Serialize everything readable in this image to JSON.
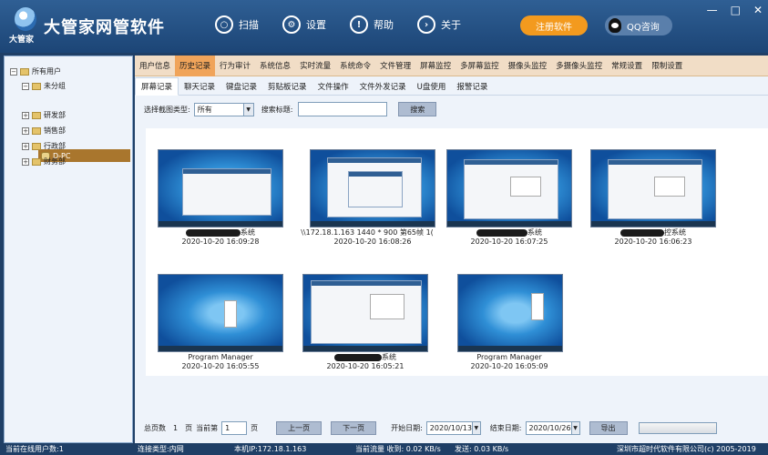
{
  "app": {
    "title": "大管家网管软件",
    "logo_sub": "大管家"
  },
  "topnav": [
    {
      "label": "扫描",
      "glyph": "○"
    },
    {
      "label": "设置",
      "glyph": "⚙"
    },
    {
      "label": "帮助",
      "glyph": "!"
    },
    {
      "label": "关于",
      "glyph": "›"
    }
  ],
  "buttons": {
    "register": "注册软件",
    "qq": "QQ咨询"
  },
  "window_controls": {
    "minimize": "—",
    "maximize": "□",
    "close": "✕"
  },
  "tree": {
    "root": "所有用户",
    "ungrouped": "未分组",
    "selected_pc": "D-PC",
    "departments": [
      "研发部",
      "销售部",
      "行政部",
      "财务部"
    ]
  },
  "tabs_primary": [
    "用户信息",
    "历史记录",
    "行为审计",
    "系统信息",
    "实时流量",
    "系统命令",
    "文件管理",
    "屏幕监控",
    "多屏幕监控",
    "摄像头监控",
    "多摄像头监控",
    "常规设置",
    "限制设置"
  ],
  "tabs_primary_active": 1,
  "tabs_secondary": [
    "屏幕记录",
    "聊天记录",
    "键盘记录",
    "剪贴板记录",
    "文件操作",
    "文件外发记录",
    "U盘使用",
    "报警记录"
  ],
  "tabs_secondary_active": 0,
  "filter": {
    "type_label": "选择截图类型:",
    "type_value": "所有",
    "title_label": "搜索标题:",
    "title_value": "",
    "search_button": "搜索"
  },
  "screenshots": [
    {
      "title_prefix": "",
      "title_suffix": "系统",
      "time": "2020-10-20 16:09:28"
    },
    {
      "title_prefix": "\\\\172.18.1.163 1440 * 900 第65帧 1(",
      "title_suffix": "",
      "time": "2020-10-20 16:08:26"
    },
    {
      "title_prefix": "",
      "title_suffix": "系统",
      "time": "2020-10-20 16:07:25"
    },
    {
      "title_prefix": "",
      "title_suffix": "控系统",
      "time": "2020-10-20 16:06:23"
    },
    {
      "title_prefix": "Program Manager",
      "title_suffix": "",
      "time": "2020-10-20 16:05:55"
    },
    {
      "title_prefix": "",
      "title_suffix": "系统",
      "time": "2020-10-20 16:05:21"
    },
    {
      "title_prefix": "Program Manager",
      "title_suffix": "",
      "time": "2020-10-20 16:05:09"
    }
  ],
  "pager": {
    "total_label": "总页数",
    "total_pages": "1",
    "page_unit": "页",
    "current_label": "当前第",
    "current_page": "1",
    "prev": "上一页",
    "next": "下一页",
    "start_label": "开始日期:",
    "start_date": "2020/10/13",
    "end_label": "结束日期:",
    "end_date": "2020/10/26",
    "export": "导出"
  },
  "status": {
    "online": "当前在线用户数:1",
    "conn": "连接类型:内网",
    "ip": "本机IP:172.18.1.163",
    "flow": "当前流量 收到: 0.02 KB/s",
    "send": "发送: 0.03 KB/s",
    "copyright": "深圳市超时代软件有限公司(c) 2005-2019"
  }
}
